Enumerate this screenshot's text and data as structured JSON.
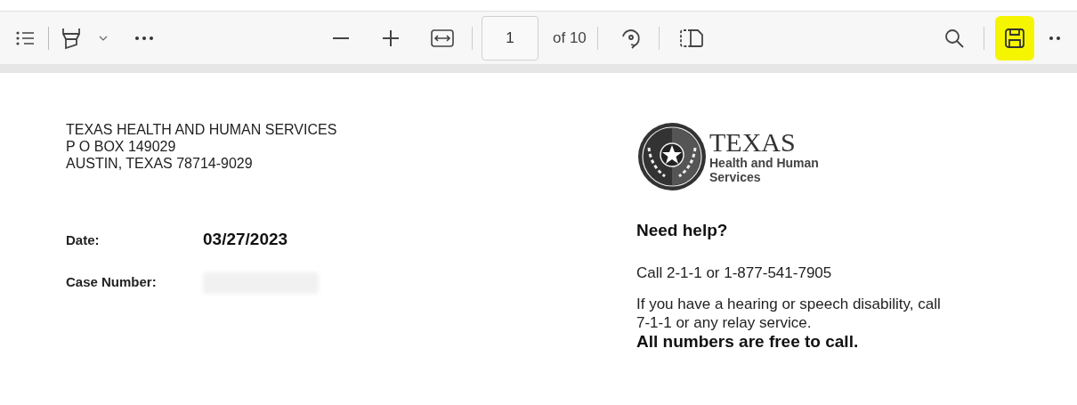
{
  "toolbar": {
    "page_number": "1",
    "page_count": "of 10",
    "save_highlighted": true
  },
  "letter": {
    "sender": [
      "TEXAS HEALTH AND HUMAN SERVICES",
      "P O BOX 149029",
      "AUSTIN, TEXAS 78714-9029"
    ],
    "logo": {
      "title": "TEXAS",
      "subtitle": "Health and Human",
      "subtitle_2": "Services"
    },
    "fields": [
      {
        "label": "Date:",
        "value": "03/27/2023",
        "redacted": false
      },
      {
        "label": "Case Number:",
        "redacted": true
      }
    ],
    "help": {
      "heading": "Need help?",
      "call": "Call 2-1-1 or 1-877-541-7905",
      "disability": "If you have a hearing or speech disability, call 7-1-1 or any relay service.",
      "free": "All numbers are free to call."
    }
  }
}
